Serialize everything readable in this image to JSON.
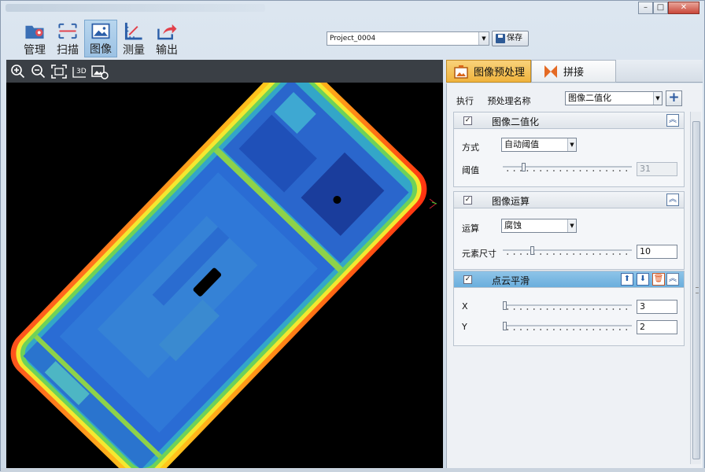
{
  "toolbar": {
    "items": [
      {
        "label": "管理",
        "icon": "gear-folder-icon"
      },
      {
        "label": "扫描",
        "icon": "scan-icon"
      },
      {
        "label": "图像",
        "icon": "image-icon"
      },
      {
        "label": "测量",
        "icon": "ruler-icon"
      },
      {
        "label": "输出",
        "icon": "export-icon"
      }
    ],
    "active_index": 2
  },
  "project": {
    "selected": "Project_0004"
  },
  "save_label": "保存",
  "viewer": {
    "tools": [
      "zoom-in-icon",
      "zoom-out-icon",
      "fit-view-icon",
      "3d-view-icon",
      "image-refresh-icon"
    ],
    "tool_3d_text": "3D"
  },
  "tabs": [
    {
      "label": "图像预处理",
      "icon": "image-process-icon",
      "active": true
    },
    {
      "label": "拼接",
      "icon": "stitch-icon",
      "active": false
    }
  ],
  "panel": {
    "exec_label": "执行",
    "preprocess_name_label": "预处理名称",
    "preprocess_selected": "图像二值化",
    "sections": [
      {
        "title": "图像二值化",
        "checked": true,
        "method_label": "方式",
        "method_value": "自动阈值",
        "threshold_label": "阈值",
        "threshold_value": "31",
        "threshold_level": 0.15
      },
      {
        "title": "图像运算",
        "checked": true,
        "op_label": "运算",
        "op_value": "腐蚀",
        "size_label": "元素尺寸",
        "size_value": "10",
        "size_level": 0.22
      },
      {
        "title": "点云平滑",
        "checked": true,
        "x_label": "X",
        "x_value": "3",
        "y_label": "Y",
        "y_value": "2",
        "x_level": 0.0,
        "y_level": 0.0
      }
    ]
  },
  "colors": {
    "accent_tab": "#efb33d",
    "active_section_header": "#7ab8e2",
    "viewport_bg": "#000000"
  }
}
